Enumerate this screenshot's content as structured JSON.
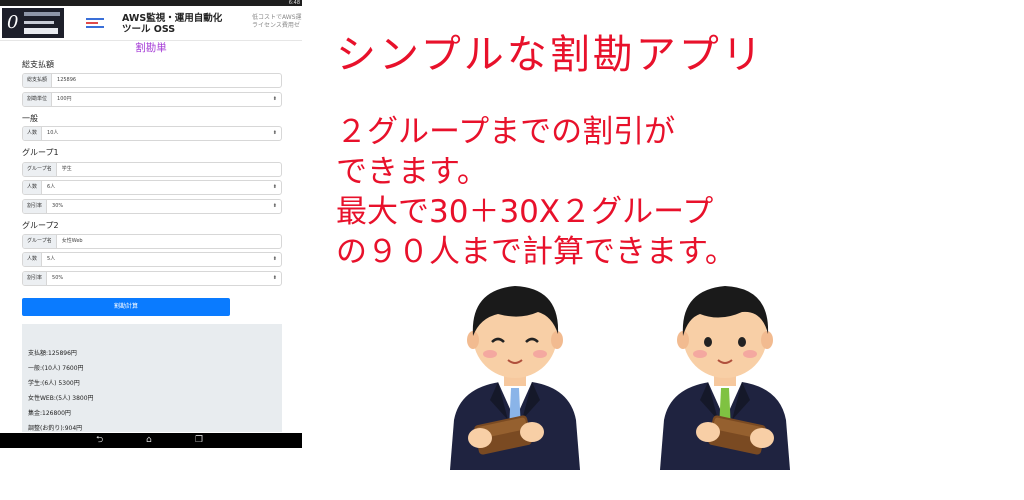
{
  "status_bar": {
    "time": "6:48"
  },
  "ad": {
    "title_line1": "AWS監視・運用自動化",
    "title_line2": "ツール OSS",
    "side_line1": "低コストでAWS運",
    "side_line2": "ライセンス費用ゼ"
  },
  "app": {
    "title": "割勘単",
    "total_section": "総支払額",
    "total_label": "総支払額",
    "total_value": "125896",
    "unit_label": "割勘単位",
    "unit_value": "100円",
    "general_section": "一般",
    "general_count_label": "人数",
    "general_count_value": "10人",
    "group1_section": "グループ1",
    "group1_name_label": "グループ名",
    "group1_name_value": "学生",
    "group1_count_label": "人数",
    "group1_count_value": "6人",
    "group1_discount_label": "割引率",
    "group1_discount_value": "30%",
    "group2_section": "グループ2",
    "group2_name_label": "グループ名",
    "group2_name_value": "女性Web",
    "group2_count_label": "人数",
    "group2_count_value": "5人",
    "group2_discount_label": "割引率",
    "group2_discount_value": "50%",
    "calc_button": "割勘計算",
    "results": [
      "支払額:125896円",
      "一般:(10人) 7600円",
      "学生:(6人) 5300円",
      "女性WEB:(5人) 3800円",
      "集金:126800円",
      "調整(お釣り):904円"
    ]
  },
  "promo": {
    "headline": "シンプルな割勘アプリ",
    "line1": "２グループまでの割引が",
    "line2": "できます。",
    "line3": "最大で30＋30X２グループ",
    "line4": "の９０人まで計算できます。"
  },
  "colors": {
    "accent_red": "#e8112b",
    "app_title_purple": "#a43ad6",
    "button_blue": "#0a7bff"
  },
  "icons": {
    "nav_back": "back-icon",
    "nav_home": "home-icon",
    "nav_recent": "recent-apps-icon"
  }
}
